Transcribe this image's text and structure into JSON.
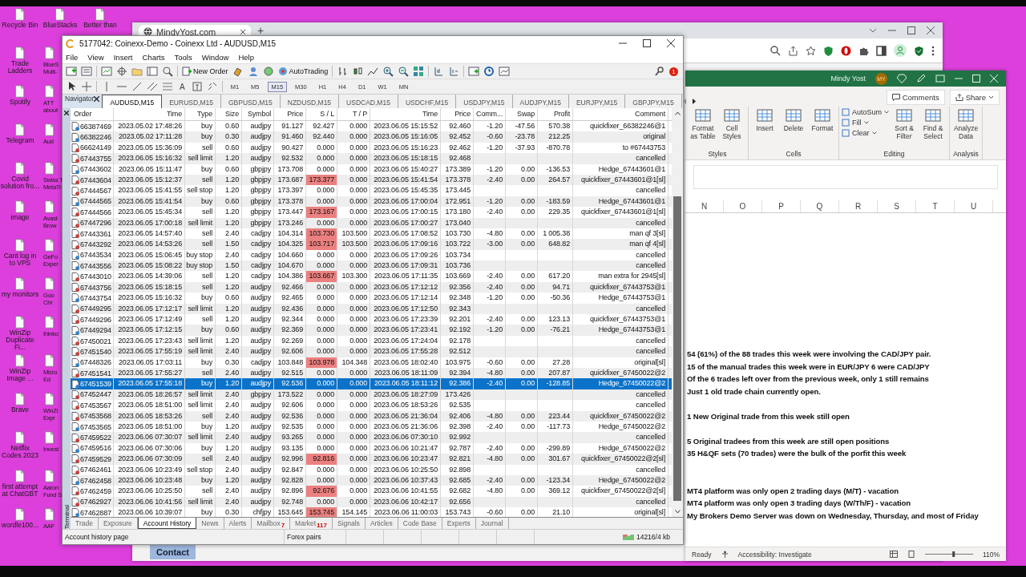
{
  "desktop": {
    "top_icons": [
      {
        "label": "Recycle Bin"
      },
      {
        "label": "BlueStacks"
      },
      {
        "label": "Better than"
      }
    ],
    "icons": [
      {
        "label": "Trade Ladders",
        "side": "BlueS Multi-"
      },
      {
        "label": "Spotify",
        "side": "ATT about"
      },
      {
        "label": "Telegram",
        "side": "Aud"
      },
      {
        "label": "Covid solution fro...",
        "side": "Swiss T MetaTr"
      },
      {
        "label": "image",
        "side": "Avast Brow"
      },
      {
        "label": "Cant log in to VPS",
        "side": "GeFo Exper"
      },
      {
        "label": "my monitors",
        "side": "Goo Chr"
      },
      {
        "label": "WinZip Duplicate Fi...",
        "side": "thinko"
      },
      {
        "label": "WinZip Image ...",
        "side": "Micro Ed"
      },
      {
        "label": "Brave",
        "side": "WinZi Expr"
      },
      {
        "label": "Netflix Codes 2023",
        "side": "Invest"
      },
      {
        "label": "first attempt at ChatGBT",
        "side": "Aaron Fund S"
      },
      {
        "label": "wordle100...",
        "side": "AAF"
      }
    ]
  },
  "browser": {
    "tab": "MindyYost.com",
    "new_tab": "+",
    "page_button": "Contact"
  },
  "mt4": {
    "title": "5177042: Coinexx-Demo - Coinexx Ltd - AUDUSD,M15",
    "menu": [
      "File",
      "View",
      "Insert",
      "Charts",
      "Tools",
      "Window",
      "Help"
    ],
    "new_order": "New Order",
    "autotrading": "AutoTrading",
    "notifications": "1",
    "text_tool": "A",
    "timeframes": [
      {
        "label": "M1",
        "selected": false
      },
      {
        "label": "M5",
        "selected": false
      },
      {
        "label": "M15",
        "selected": true
      },
      {
        "label": "M30",
        "selected": false
      },
      {
        "label": "H1",
        "selected": false
      },
      {
        "label": "H4",
        "selected": false
      },
      {
        "label": "D1",
        "selected": false
      },
      {
        "label": "W1",
        "selected": false
      },
      {
        "label": "MN",
        "selected": false
      }
    ],
    "navigator": "Navigator",
    "chart_tabs": [
      {
        "label": "AUDUSD,M15",
        "selected": true
      },
      {
        "label": "EURUSD,M15",
        "selected": false
      },
      {
        "label": "GBPUSD,M15",
        "selected": false
      },
      {
        "label": "NZDUSD,M15",
        "selected": false
      },
      {
        "label": "USDCAD,M15",
        "selected": false
      },
      {
        "label": "USDCHF,M15",
        "selected": false
      },
      {
        "label": "USDJPY,M15",
        "selected": false
      },
      {
        "label": "AUDJPY,M15",
        "selected": false
      },
      {
        "label": "EURJPY,M15",
        "selected": false
      },
      {
        "label": "GBPJPY,M15",
        "selected": false
      }
    ],
    "columns": [
      "Order",
      "Time",
      "Type",
      "Size",
      "Symbol",
      "Price",
      "S / L",
      "T / P",
      "Time",
      "Price",
      "Comm...",
      "Swap",
      "Profit",
      "Comment"
    ],
    "rows": [
      {
        "kind": "buy",
        "selected": false,
        "sl_hit": false,
        "open": [
          "66387469",
          "2023.05.02 17:48:26",
          "buy",
          "0.60",
          "audjpy",
          "91.127",
          "92.427",
          "0.000"
        ],
        "close": [
          "2023.06.05 15:15:52",
          "92.460"
        ],
        "costs": [
          "-1.20",
          "-47.56",
          "570.38"
        ],
        "comment": "quickfixer_66382246@1"
      },
      {
        "kind": "buy",
        "selected": false,
        "sl_hit": false,
        "open": [
          "66382246",
          "2023.05.02 17:11:28",
          "buy",
          "0.30",
          "audjpy",
          "91.460",
          "92.440",
          "0.000"
        ],
        "close": [
          "2023.06.05 15:16:05",
          "92.452"
        ],
        "costs": [
          "-0.60",
          "-23.78",
          "212.25"
        ],
        "comment": "original"
      },
      {
        "kind": "sell",
        "selected": false,
        "sl_hit": false,
        "open": [
          "66624149",
          "2023.05.05 15:36:09",
          "sell",
          "0.60",
          "audjpy",
          "90.427",
          "0.000",
          "0.000"
        ],
        "close": [
          "2023.06.05 15:16:23",
          "92.462"
        ],
        "costs": [
          "-1.20",
          "-37.93",
          "-870.78"
        ],
        "comment": "to #67443753"
      },
      {
        "kind": "sell",
        "selected": false,
        "sl_hit": false,
        "open": [
          "67443755",
          "2023.06.05 15:16:32",
          "sell limit",
          "1.20",
          "audjpy",
          "92.532",
          "0.000",
          "0.000"
        ],
        "close": [
          "2023.06.05 15:18:15",
          "92.468"
        ],
        "comment": "cancelled"
      },
      {
        "kind": "buy",
        "selected": false,
        "sl_hit": false,
        "open": [
          "67443602",
          "2023.06.05 15:11:47",
          "buy",
          "0.60",
          "gbpjpy",
          "173.708",
          "0.000",
          "0.000"
        ],
        "close": [
          "2023.06.05 15:40:27",
          "173.389"
        ],
        "costs": [
          "-1.20",
          "0.00",
          "-136.53"
        ],
        "comment": "Hedge_67443601@1"
      },
      {
        "kind": "sell",
        "selected": false,
        "sl_hit": true,
        "open": [
          "67443604",
          "2023.06.05 15:12:37",
          "sell",
          "1.20",
          "gbpjpy",
          "173.687",
          "173.377",
          "0.000"
        ],
        "close": [
          "2023.06.05 15:41:54",
          "173.378"
        ],
        "costs": [
          "-2.40",
          "0.00",
          "264.57"
        ],
        "comment": "quickfixer_67443601@1[sl]"
      },
      {
        "kind": "sell",
        "selected": false,
        "sl_hit": false,
        "open": [
          "67444567",
          "2023.06.05 15:41:55",
          "sell stop",
          "1.20",
          "gbpjpy",
          "173.397",
          "0.000",
          "0.000"
        ],
        "close": [
          "2023.06.05 15:45:35",
          "173.445"
        ],
        "comment": "cancelled"
      },
      {
        "kind": "buy",
        "selected": false,
        "sl_hit": false,
        "open": [
          "67444565",
          "2023.06.05 15:41:54",
          "buy",
          "0.60",
          "gbpjpy",
          "173.378",
          "0.000",
          "0.000"
        ],
        "close": [
          "2023.06.05 17:00:04",
          "172.951"
        ],
        "costs": [
          "-1.20",
          "0.00",
          "-183.59"
        ],
        "comment": "Hedge_67443601@1"
      },
      {
        "kind": "sell",
        "selected": false,
        "sl_hit": true,
        "open": [
          "67444566",
          "2023.06.05 15:45:34",
          "sell",
          "1.20",
          "gbpjpy",
          "173.447",
          "173.167",
          "0.000"
        ],
        "close": [
          "2023.06.05 17:00:15",
          "173.180"
        ],
        "costs": [
          "-2.40",
          "0.00",
          "229.35"
        ],
        "comment": "quickfixer_67443601@1[sl]"
      },
      {
        "kind": "sell",
        "selected": false,
        "sl_hit": false,
        "open": [
          "67447296",
          "2023.06.05 17:00:18",
          "sell limit",
          "1.20",
          "gbpjpy",
          "173.246",
          "0.000",
          "0.000"
        ],
        "close": [
          "2023.06.05 17:00:27",
          "173.040"
        ],
        "comment": "cancelled"
      },
      {
        "kind": "sell",
        "selected": false,
        "sl_hit": true,
        "open": [
          "67443361",
          "2023.06.05 14:57:40",
          "sell",
          "2.40",
          "cadjpy",
          "104.314",
          "103.730",
          "103.500"
        ],
        "close": [
          "2023.06.05 17:08:52",
          "103.730"
        ],
        "costs": [
          "-4.80",
          "0.00",
          "1 005.38"
        ],
        "comment": "man qf 3[sl]"
      },
      {
        "kind": "sell",
        "selected": false,
        "sl_hit": true,
        "open": [
          "67443292",
          "2023.06.05 14:53:26",
          "sell",
          "1.50",
          "cadjpy",
          "104.325",
          "103.717",
          "103.500"
        ],
        "close": [
          "2023.06.05 17:09:16",
          "103.722"
        ],
        "costs": [
          "-3.00",
          "0.00",
          "648.82"
        ],
        "comment": "man qf 4[sl]"
      },
      {
        "kind": "buy",
        "selected": false,
        "sl_hit": false,
        "open": [
          "67443534",
          "2023.06.05 15:06:45",
          "buy stop",
          "2.40",
          "cadjpy",
          "104.660",
          "0.000",
          "0.000"
        ],
        "close": [
          "2023.06.05 17:09:26",
          "103.734"
        ],
        "comment": "cancelled"
      },
      {
        "kind": "buy",
        "selected": false,
        "sl_hit": false,
        "open": [
          "67443556",
          "2023.06.05 15:08:22",
          "buy stop",
          "1.50",
          "cadjpy",
          "104.670",
          "0.000",
          "0.000"
        ],
        "close": [
          "2023.06.05 17:09:31",
          "103.736"
        ],
        "comment": "cancelled"
      },
      {
        "kind": "sell",
        "selected": false,
        "sl_hit": true,
        "open": [
          "67443010",
          "2023.06.05 14:39:06",
          "sell",
          "1.20",
          "cadjpy",
          "104.386",
          "103.667",
          "103.300"
        ],
        "close": [
          "2023.06.05 17:11:35",
          "103.669"
        ],
        "costs": [
          "-2.40",
          "0.00",
          "617.20"
        ],
        "comment": "man extra for 2945[sl]"
      },
      {
        "kind": "sell",
        "selected": false,
        "sl_hit": false,
        "open": [
          "67443756",
          "2023.06.05 15:18:15",
          "sell",
          "1.20",
          "audjpy",
          "92.466",
          "0.000",
          "0.000"
        ],
        "close": [
          "2023.06.05 17:12:12",
          "92.356"
        ],
        "costs": [
          "-2.40",
          "0.00",
          "94.71"
        ],
        "comment": "quickfixer_67443753@1"
      },
      {
        "kind": "buy",
        "selected": false,
        "sl_hit": false,
        "open": [
          "67443754",
          "2023.06.05 15:16:32",
          "buy",
          "0.60",
          "audjpy",
          "92.465",
          "0.000",
          "0.000"
        ],
        "close": [
          "2023.06.05 17:12:14",
          "92.348"
        ],
        "costs": [
          "-1.20",
          "0.00",
          "-50.36"
        ],
        "comment": "Hedge_67443753@1"
      },
      {
        "kind": "sell",
        "selected": false,
        "sl_hit": false,
        "open": [
          "67449295",
          "2023.06.05 17:12:17",
          "sell limit",
          "1.20",
          "audjpy",
          "92.436",
          "0.000",
          "0.000"
        ],
        "close": [
          "2023.06.05 17:12:50",
          "92.343"
        ],
        "comment": "cancelled"
      },
      {
        "kind": "sell",
        "selected": false,
        "sl_hit": false,
        "open": [
          "67449296",
          "2023.06.05 17:12:49",
          "sell",
          "1.20",
          "audjpy",
          "92.344",
          "0.000",
          "0.000"
        ],
        "close": [
          "2023.06.05 17:23:39",
          "92.201"
        ],
        "costs": [
          "-2.40",
          "0.00",
          "123.13"
        ],
        "comment": "quickfixer_67443753@1"
      },
      {
        "kind": "buy",
        "selected": false,
        "sl_hit": false,
        "open": [
          "67449294",
          "2023.06.05 17:12:15",
          "buy",
          "0.60",
          "audjpy",
          "92.369",
          "0.000",
          "0.000"
        ],
        "close": [
          "2023.06.05 17:23:41",
          "92.192"
        ],
        "costs": [
          "-1.20",
          "0.00",
          "-76.21"
        ],
        "comment": "Hedge_67443753@1"
      },
      {
        "kind": "sell",
        "selected": false,
        "sl_hit": false,
        "open": [
          "67450021",
          "2023.06.05 17:23:43",
          "sell limit",
          "1.20",
          "audjpy",
          "92.269",
          "0.000",
          "0.000"
        ],
        "close": [
          "2023.06.05 17:24:04",
          "92.178"
        ],
        "comment": "cancelled"
      },
      {
        "kind": "sell",
        "selected": false,
        "sl_hit": false,
        "open": [
          "67451540",
          "2023.06.05 17:55:19",
          "sell limit",
          "2.40",
          "audjpy",
          "92.606",
          "0.000",
          "0.000"
        ],
        "close": [
          "2023.06.05 17:55:28",
          "92.512"
        ],
        "comment": "cancelled"
      },
      {
        "kind": "buy",
        "selected": false,
        "sl_hit": true,
        "open": [
          "67448326",
          "2023.06.05 17:03:11",
          "buy",
          "0.30",
          "cadjpy",
          "103.848",
          "103.978",
          "104.348"
        ],
        "close": [
          "2023.06.05 18:02:40",
          "103.975"
        ],
        "costs": [
          "-0.60",
          "0.00",
          "27.28"
        ],
        "comment": "original[sl]"
      },
      {
        "kind": "sell",
        "selected": false,
        "sl_hit": false,
        "open": [
          "67451541",
          "2023.06.05 17:55:27",
          "sell",
          "2.40",
          "audjpy",
          "92.515",
          "0.000",
          "0.000"
        ],
        "close": [
          "2023.06.05 18:11:09",
          "92.394"
        ],
        "costs": [
          "-4.80",
          "0.00",
          "207.87"
        ],
        "comment": "quickfixer_67450022@2"
      },
      {
        "kind": "buy",
        "selected": true,
        "sl_hit": false,
        "open": [
          "67451539",
          "2023.06.05 17:55:18",
          "buy",
          "1.20",
          "audjpy",
          "92.536",
          "0.000",
          "0.000"
        ],
        "close": [
          "2023.06.05 18:11:12",
          "92.386"
        ],
        "costs": [
          "-2.40",
          "0.00",
          "-128.85"
        ],
        "comment": "Hedge_67450022@2"
      },
      {
        "kind": "sell",
        "selected": false,
        "sl_hit": false,
        "open": [
          "67452447",
          "2023.06.05 18:26:57",
          "sell limit",
          "2.40",
          "gbpjpy",
          "173.522",
          "0.000",
          "0.000"
        ],
        "close": [
          "2023.06.05 18:27:09",
          "173.426"
        ],
        "comment": "cancelled"
      },
      {
        "kind": "sell",
        "selected": false,
        "sl_hit": false,
        "open": [
          "67453567",
          "2023.06.05 18:51:00",
          "sell limit",
          "2.40",
          "audjpy",
          "92.606",
          "0.000",
          "0.000"
        ],
        "close": [
          "2023.06.05 18:53:26",
          "92.535"
        ],
        "comment": "cancelled"
      },
      {
        "kind": "sell",
        "selected": false,
        "sl_hit": false,
        "open": [
          "67453568",
          "2023.06.05 18:53:26",
          "sell",
          "2.40",
          "audjpy",
          "92.536",
          "0.000",
          "0.000"
        ],
        "close": [
          "2023.06.05 21:36:04",
          "92.406"
        ],
        "costs": [
          "-4.80",
          "0.00",
          "223.44"
        ],
        "comment": "quickfixer_67450022@2"
      },
      {
        "kind": "buy",
        "selected": false,
        "sl_hit": false,
        "open": [
          "67453565",
          "2023.06.05 18:51:00",
          "buy",
          "1.20",
          "audjpy",
          "92.535",
          "0.000",
          "0.000"
        ],
        "close": [
          "2023.06.05 21:36:06",
          "92.398"
        ],
        "costs": [
          "-2.40",
          "0.00",
          "-117.73"
        ],
        "comment": "Hedge_67450022@2"
      },
      {
        "kind": "sell",
        "selected": false,
        "sl_hit": false,
        "open": [
          "67459522",
          "2023.06.06 07:30:07",
          "sell limit",
          "2.40",
          "audjpy",
          "93.265",
          "0.000",
          "0.000"
        ],
        "close": [
          "2023.06.06 07:30:10",
          "92.992"
        ],
        "comment": "cancelled"
      },
      {
        "kind": "buy",
        "selected": false,
        "sl_hit": false,
        "open": [
          "67459516",
          "2023.06.06 07:30:06",
          "buy",
          "1.20",
          "audjpy",
          "93.135",
          "0.000",
          "0.000"
        ],
        "close": [
          "2023.06.06 10:21:47",
          "92.787"
        ],
        "costs": [
          "-2.40",
          "0.00",
          "-299.89"
        ],
        "comment": "Hedge_67450022@2"
      },
      {
        "kind": "sell",
        "selected": false,
        "sl_hit": true,
        "open": [
          "67459529",
          "2023.06.06 07:30:09",
          "sell",
          "2.40",
          "audjpy",
          "92.996",
          "92.816",
          "0.000"
        ],
        "close": [
          "2023.06.06 10:23:47",
          "92.821"
        ],
        "costs": [
          "-4.80",
          "0.00",
          "301.67"
        ],
        "comment": "quickfixer_67450022@2[sl]"
      },
      {
        "kind": "sell",
        "selected": false,
        "sl_hit": false,
        "open": [
          "67462461",
          "2023.06.06 10:23:49",
          "sell stop",
          "2.40",
          "audjpy",
          "92.847",
          "0.000",
          "0.000"
        ],
        "close": [
          "2023.06.06 10:25:50",
          "92.898"
        ],
        "comment": "cancelled"
      },
      {
        "kind": "buy",
        "selected": false,
        "sl_hit": false,
        "open": [
          "67462458",
          "2023.06.06 10:23:48",
          "buy",
          "1.20",
          "audjpy",
          "92.828",
          "0.000",
          "0.000"
        ],
        "close": [
          "2023.06.06 10:37:43",
          "92.685"
        ],
        "costs": [
          "-2.40",
          "0.00",
          "-123.34"
        ],
        "comment": "Hedge_67450022@2"
      },
      {
        "kind": "sell",
        "selected": false,
        "sl_hit": true,
        "open": [
          "67462459",
          "2023.06.06 10:25:50",
          "sell",
          "2.40",
          "audjpy",
          "92.896",
          "92.676",
          "0.000"
        ],
        "close": [
          "2023.06.06 10:41:55",
          "92.682"
        ],
        "costs": [
          "-4.80",
          "0.00",
          "369.12"
        ],
        "comment": "quickfixer_67450022@2[sl]"
      },
      {
        "kind": "sell",
        "selected": false,
        "sl_hit": false,
        "open": [
          "67462927",
          "2023.06.06 10:41:56",
          "sell limit",
          "2.40",
          "audjpy",
          "92.748",
          "0.000",
          "0.000"
        ],
        "close": [
          "2023.06.06 10:42:17",
          "92.656"
        ],
        "comment": "cancelled"
      },
      {
        "kind": "buy",
        "selected": false,
        "sl_hit": true,
        "open": [
          "67462887",
          "2023.06.06 10:39:07",
          "buy",
          "0.30",
          "chfjpy",
          "153.645",
          "153.745",
          "154.145"
        ],
        "close": [
          "2023.06.06 11:00:03",
          "153.743"
        ],
        "costs": [
          "-0.60",
          "0.00",
          "21.10"
        ],
        "comment": "original[sl]"
      }
    ],
    "side_label": "Terminal",
    "bottom_tabs": [
      {
        "label": "Trade",
        "selected": false
      },
      {
        "label": "Exposure",
        "selected": false
      },
      {
        "label": "Account History",
        "selected": true
      },
      {
        "label": "News",
        "selected": false
      },
      {
        "label": "Alerts",
        "selected": false
      },
      {
        "label": "Mailbox",
        "badge": "7",
        "selected": false
      },
      {
        "label": "Market",
        "badge": "117",
        "selected": false
      },
      {
        "label": "Signals",
        "selected": false
      },
      {
        "label": "Articles",
        "selected": false
      },
      {
        "label": "Code Base",
        "selected": false
      },
      {
        "label": "Experts",
        "selected": false
      },
      {
        "label": "Journal",
        "selected": false
      }
    ],
    "status": {
      "hint": "Account history page",
      "profile": "Forex pairs",
      "traffic": "14216/4 kb"
    }
  },
  "excel": {
    "user": "Mindy Yost",
    "initials": "MY",
    "comments": "Comments",
    "share": "Share",
    "groups": [
      {
        "label": "Styles",
        "buttons": [
          {
            "kind": "large",
            "label": "Format as Table"
          },
          {
            "kind": "large",
            "label": "Cell Styles"
          }
        ]
      },
      {
        "label": "Cells",
        "buttons": [
          {
            "kind": "large",
            "label": "Insert"
          },
          {
            "kind": "large",
            "label": "Delete"
          },
          {
            "kind": "large",
            "label": "Format"
          }
        ]
      },
      {
        "label": "Editing",
        "buttons": [
          {
            "kind": "small",
            "label": "AutoSum"
          },
          {
            "kind": "small",
            "label": "Fill"
          },
          {
            "kind": "small",
            "label": "Clear"
          },
          {
            "kind": "large",
            "label": "Sort & Filter"
          },
          {
            "kind": "large",
            "label": "Find & Select"
          }
        ]
      },
      {
        "label": "Analysis",
        "buttons": [
          {
            "kind": "large",
            "label": "Analyze Data"
          }
        ]
      }
    ],
    "columns": [
      "N",
      "O",
      "P",
      "Q",
      "R",
      "S",
      "T",
      "U"
    ],
    "lines": [
      {
        "kind": "line",
        "text": "54 (61%) of the 88 trades this week were involving the CAD/JPY pair."
      },
      {
        "kind": "line",
        "text": "15 of the manual trades this week were in EUR/JPY  6 were CAD/JPY"
      },
      {
        "kind": "line",
        "text": "Of the 6 trades left over from the previous week, only 1 still remains"
      },
      {
        "kind": "line",
        "text": "Just 1 old trade chain currently open."
      },
      {
        "kind": "after_blank",
        "text": "1 New Original trade from this week still open"
      },
      {
        "kind": "after_blank",
        "text": "5 Original tradees from this week are still open positions"
      },
      {
        "kind": "line",
        "text": "35 H&QF sets (70 trades) were the bulk of the porfit this week"
      },
      {
        "kind": "after_two_blanks",
        "text": "MT4 platform was only open 2 trading days (M/T) - vacation"
      },
      {
        "kind": "line",
        "text": "MT4 platform was only open 3 trading days (W/Th/F) - vacation"
      },
      {
        "kind": "line",
        "text": "My Brokers Demo Server was down on Wednesday, Thursday, and most of Friday"
      }
    ],
    "status": {
      "ready": "Ready",
      "accessibility": "Accessibility: Investigate",
      "zoom": "110%",
      "level": 0.6
    }
  }
}
